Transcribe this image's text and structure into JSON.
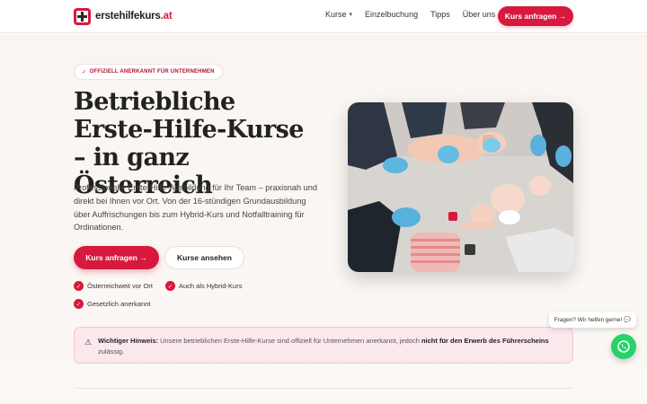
{
  "header": {
    "logo_text": "erstehilfekurs",
    "logo_tld": ".at",
    "nav": [
      {
        "label": "Kurse",
        "has_dropdown": true
      },
      {
        "label": "Einzelbuchung"
      },
      {
        "label": "Tipps"
      },
      {
        "label": "Über uns"
      }
    ],
    "cta_label": "Kurs anfragen →"
  },
  "hero": {
    "badge": "OFFIZIELL ANERKANNT FÜR UNTERNEHMEN",
    "badge_icon": "✓",
    "title": "Betriebliche Erste-Hilfe-Kurse – in ganz Österreich",
    "lead": "Professionelle Erste-Hilfe-Ausbildung für Ihr Team – praxisnah und direkt bei Ihnen vor Ort. Von der 16-stündigen Grundausbildung über Auffrischungen bis zum Hybrid-Kurs und Notfalltraining für Ordinationen.",
    "primary_button": "Kurs anfragen →",
    "secondary_button": "Kurse ansehen",
    "features": [
      "Österreichweit vor Ort",
      "Auch als Hybrid-Kurs",
      "Gesetzlich anerkannt"
    ],
    "feature_icon": "✓"
  },
  "notice": {
    "icon": "⚠",
    "label": "Wichtiger Hinweis:",
    "text_before": " Unsere betrieblichen Erste-Hilfe-Kurse sind offiziell für Unternehmen anerkannt, jedoch ",
    "text_bold": "nicht für den Erwerb des Führerscheins",
    "text_after": " zulässig."
  },
  "chat": {
    "bubble": "Fragen? Wir helfen gerne! 💬"
  },
  "colors": {
    "accent": "#d7193d",
    "whatsapp": "#25d366",
    "notice_bg": "#fbe8ec"
  }
}
